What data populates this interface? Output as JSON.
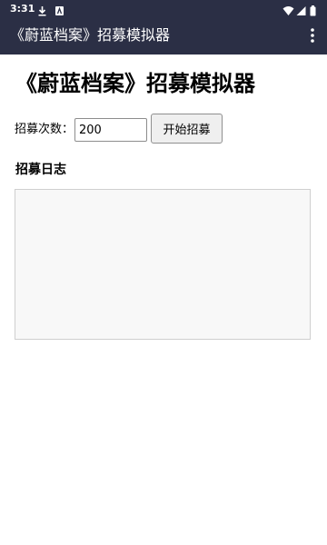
{
  "status_bar": {
    "time": "3:31",
    "icons": [
      "download-icon",
      "app-notification-icon",
      "wifi-icon",
      "signal-icon",
      "battery-icon"
    ]
  },
  "app_bar": {
    "title": "《蔚蓝档案》招募模拟器",
    "menu_icon": "more-vert-icon"
  },
  "main": {
    "heading": "《蔚蓝档案》招募模拟器",
    "count_label": "招募次数：",
    "count_value": "200",
    "start_button_label": "开始招募",
    "log_heading": "招募日志",
    "log_entries": []
  },
  "colors": {
    "app_bar_bg": "#2b2f45",
    "log_box_bg": "#f8f8f8"
  }
}
